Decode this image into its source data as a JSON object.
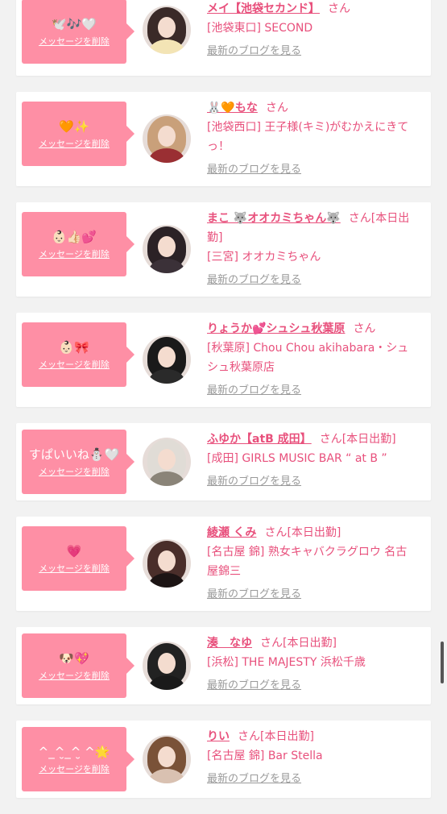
{
  "labels": {
    "delete": "メッセージを削除",
    "blog": "最新のブログを見る",
    "san": "さん"
  },
  "colors": {
    "bubble": "#fe8fa5",
    "accent": "#e8507c",
    "muted": "#9a9a9a",
    "background": "#f2f2f2"
  },
  "items": [
    {
      "sticker": "🕊️🎶🤍",
      "name": "メイ【池袋セカンド】",
      "status": "",
      "shop": "[池袋東口] SECOND",
      "avatar_hair": "#3a2a28",
      "avatar_body": "#f3e4b5"
    },
    {
      "sticker": "🧡✨",
      "name": "🐰🧡もな",
      "status": "",
      "shop": "[池袋西口] 王子様(キミ)がむかえにきてっ！",
      "avatar_hair": "#c9a07a",
      "avatar_body": "#9a2f33"
    },
    {
      "sticker": "👶🏻👍🏻💕",
      "name": "まこ 🐺オオカミちゃん🐺",
      "status": "[本日出勤]",
      "shop": "[三宮] オオカミちゃん",
      "avatar_hair": "#2b2226",
      "avatar_body": "#3b3138"
    },
    {
      "sticker": "👶🏻🎀",
      "name": "りょうか💕シュシュ秋葉原",
      "status": "",
      "shop": "[秋葉原] Chou Chou akihabara・シュシュ秋葉原店",
      "avatar_hair": "#1a1a1a",
      "avatar_body": "#2a2a2a"
    },
    {
      "sticker": "すぱいいね⛄🤍",
      "name": "ふゆか【atB 成田】",
      "status": "[本日出勤]",
      "shop": "[成田] GIRLS MUSIC BAR “ at B ”",
      "avatar_hair": "#e0dcd6",
      "avatar_body": "#8a8478"
    },
    {
      "sticker": "💗",
      "name": "綾瀬 くみ",
      "status": "[本日出勤]",
      "shop": "[名古屋 錦] 熟女キャバクラグロウ 名古屋錦三",
      "avatar_hair": "#4a2e2a",
      "avatar_body": "#1c1414"
    },
    {
      "sticker": "🐶💖",
      "name": "湊　なゆ",
      "status": "[本日出勤]",
      "shop": "[浜松] THE MAJESTY 浜松千歳",
      "avatar_hair": "#222222",
      "avatar_body": "#1a1a1a"
    },
    {
      "sticker": "^_^̮_^̮ ^🌟",
      "name": "りい",
      "status": "[本日出勤]",
      "shop": "[名古屋 錦] Bar Stella",
      "avatar_hair": "#7a5238",
      "avatar_body": "#d9c1b1"
    }
  ]
}
